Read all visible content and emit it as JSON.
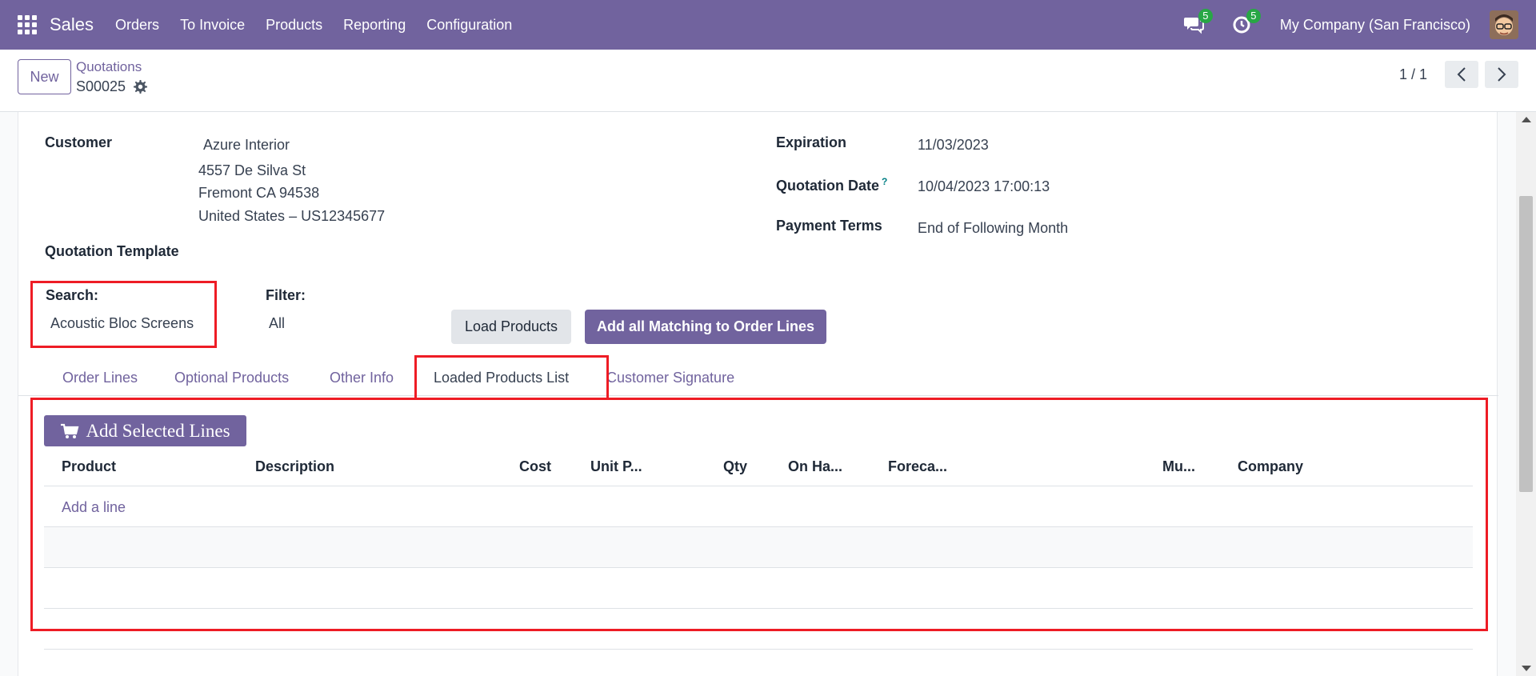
{
  "navbar": {
    "app_name": "Sales",
    "menu": [
      "Orders",
      "To Invoice",
      "Products",
      "Reporting",
      "Configuration"
    ],
    "messages_count": "5",
    "activities_count": "5",
    "company": "My Company (San Francisco)"
  },
  "control_panel": {
    "new_label": "New",
    "breadcrumb": "Quotations",
    "record_name": "S00025",
    "pager": "1 / 1"
  },
  "form": {
    "customer_label": "Customer",
    "customer_name": "Azure Interior",
    "customer_address": [
      "4557 De Silva St",
      "Fremont CA 94538",
      "United States – US12345677"
    ],
    "expiration_label": "Expiration",
    "expiration_value": "11/03/2023",
    "quotation_date_label": "Quotation Date",
    "quotation_date_help": "?",
    "quotation_date_value": "10/04/2023 17:00:13",
    "payment_terms_label": "Payment Terms",
    "payment_terms_value": "End of Following Month",
    "quotation_template_label": "Quotation Template",
    "search_label": "Search:",
    "search_value": "Acoustic Bloc Screens",
    "filter_label": "Filter:",
    "filter_value": "All",
    "load_products_label": "Load Products",
    "add_matching_label": "Add all Matching to Order Lines"
  },
  "tabs": [
    "Order Lines",
    "Optional Products",
    "Other Info",
    "Loaded Products List",
    "Customer Signature"
  ],
  "active_tab": "Loaded Products List",
  "loaded_list": {
    "add_selected_label": "Add Selected Lines",
    "columns": [
      "Product",
      "Description",
      "Cost",
      "Unit P...",
      "Qty",
      "On Ha...",
      "Foreca...",
      "Mu...",
      "Company"
    ],
    "add_line_label": "Add a line"
  },
  "colors": {
    "brand": "#71639e",
    "highlight": "#ee1c25",
    "badge": "#28a745"
  }
}
